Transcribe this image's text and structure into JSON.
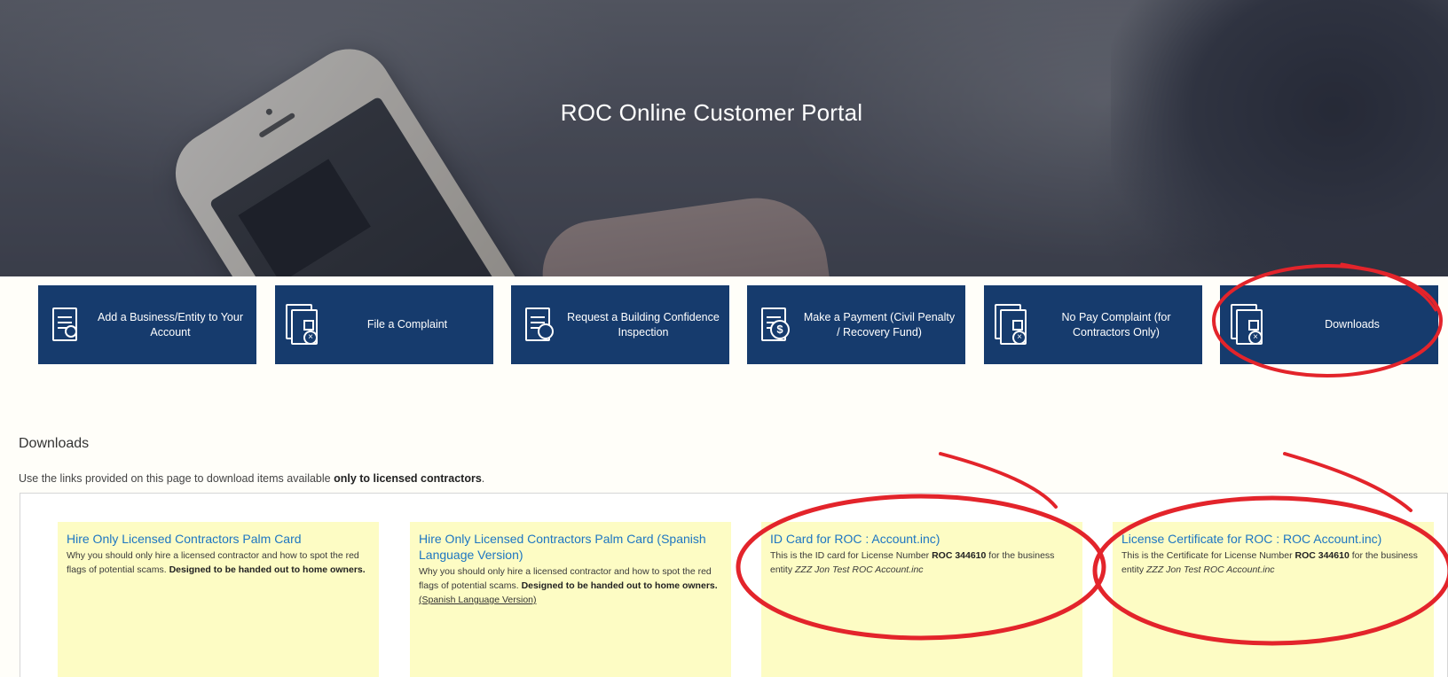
{
  "hero": {
    "title": "ROC Online Customer Portal"
  },
  "tiles": [
    {
      "label": "Add a Business/Entity to Your Account",
      "icon": "certificate-document-icon"
    },
    {
      "label": "File a Complaint",
      "icon": "complaint-document-icon"
    },
    {
      "label": "Request a Building Confidence Inspection",
      "icon": "inspection-document-icon"
    },
    {
      "label": "Make a Payment (Civil Penalty / Recovery Fund)",
      "icon": "payment-document-icon"
    },
    {
      "label": "No Pay Complaint (for Contractors Only)",
      "icon": "complaint-document-icon"
    },
    {
      "label": "Downloads",
      "icon": "downloads-document-icon"
    }
  ],
  "downloads": {
    "title": "Downloads",
    "description_before": "Use the links provided on this page to download items available ",
    "description_bold": "only to licensed contractors",
    "description_after": ".",
    "cards": [
      {
        "title": "Hire Only Licensed Contractors Palm Card",
        "desc_before": "Why you should only hire a licensed contractor and how to spot the red flags of potential scams. ",
        "desc_bold": "Designed to be handed out to home owners.",
        "desc_link": ""
      },
      {
        "title": "Hire Only Licensed Contractors Palm Card (Spanish Language Version)",
        "desc_before": "Why you should only hire a licensed contractor and how to spot the red flags of potential scams. ",
        "desc_bold": "Designed to be handed out to home owners.",
        "desc_link": "(Spanish Language Version)"
      },
      {
        "title": "ID Card for ROC : Account.inc)",
        "desc_before": "This is the ID card for License Number ",
        "desc_bold": "ROC 344610",
        "desc_after": " for the business entity ",
        "desc_italic": "ZZZ Jon Test ROC Account.inc"
      },
      {
        "title": "License Certificate for ROC : ROC Account.inc)",
        "desc_before": "This is the Certificate for License Number ",
        "desc_bold": "ROC 344610",
        "desc_after": " for the business entity ",
        "desc_italic": "ZZZ Jon Test ROC Account.inc"
      }
    ]
  },
  "colors": {
    "tile_bg": "#163b6d",
    "card_bg": "#fdfcc4",
    "link": "#1d76c2",
    "annotation": "#e3242b"
  }
}
